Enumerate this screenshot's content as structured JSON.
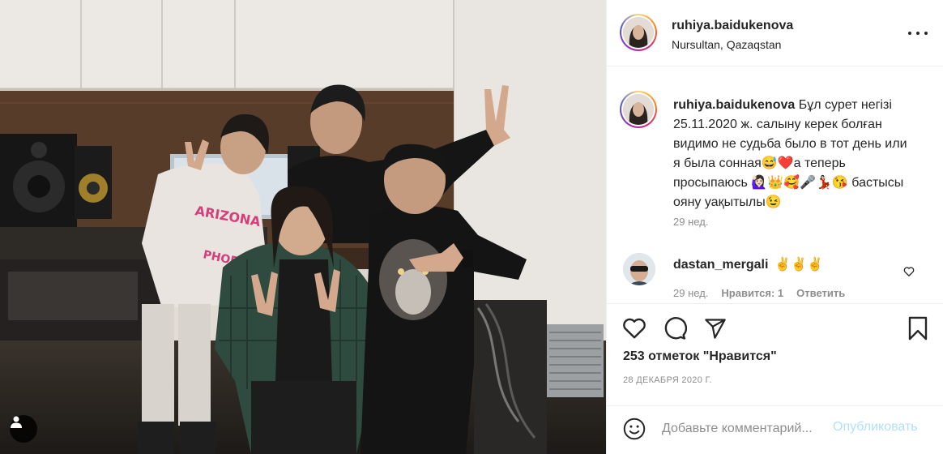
{
  "post": {
    "photo_alt": "",
    "user_tag_icon": "user-tag-icon"
  },
  "header": {
    "username": "ruhiya.baidukenova",
    "location": "Nursultan, Qazaqstan",
    "more_icon": "more-options-icon"
  },
  "caption": {
    "username": "ruhiya.baidukenova",
    "text": " Бұл сурет негізі 25.11.2020 ж. салыну керек болған видимо не судьба было в тот день или я была сонная😅❤️а теперь просыпаюсь 🙋🏻‍♀️👑🥰🎤💃🏻😘 бастысы ояну уақытылы😉",
    "time": "29 нед."
  },
  "comments": [
    {
      "username": "dastan_mergali",
      "text": "✌️✌️✌️",
      "time": "29 нед.",
      "likes": "Нравится: 1",
      "reply": "Ответить"
    }
  ],
  "actions": {
    "like_icon": "heart-icon",
    "comment_icon": "comment-bubble-icon",
    "share_icon": "paper-plane-icon",
    "save_icon": "bookmark-icon",
    "likes_count": "253 отметок \"Нравится\"",
    "date": "28 ДЕКАБРЯ 2020 Г."
  },
  "add_comment": {
    "emoji_icon": "emoji-smiley-icon",
    "placeholder": "Добавьте комментарий...",
    "publish_label": "Опубликовать"
  },
  "colors": {
    "text": "#262626",
    "secondary": "#8e8e8e",
    "publish_disabled": "#b2dffc",
    "divider": "#efefef"
  }
}
